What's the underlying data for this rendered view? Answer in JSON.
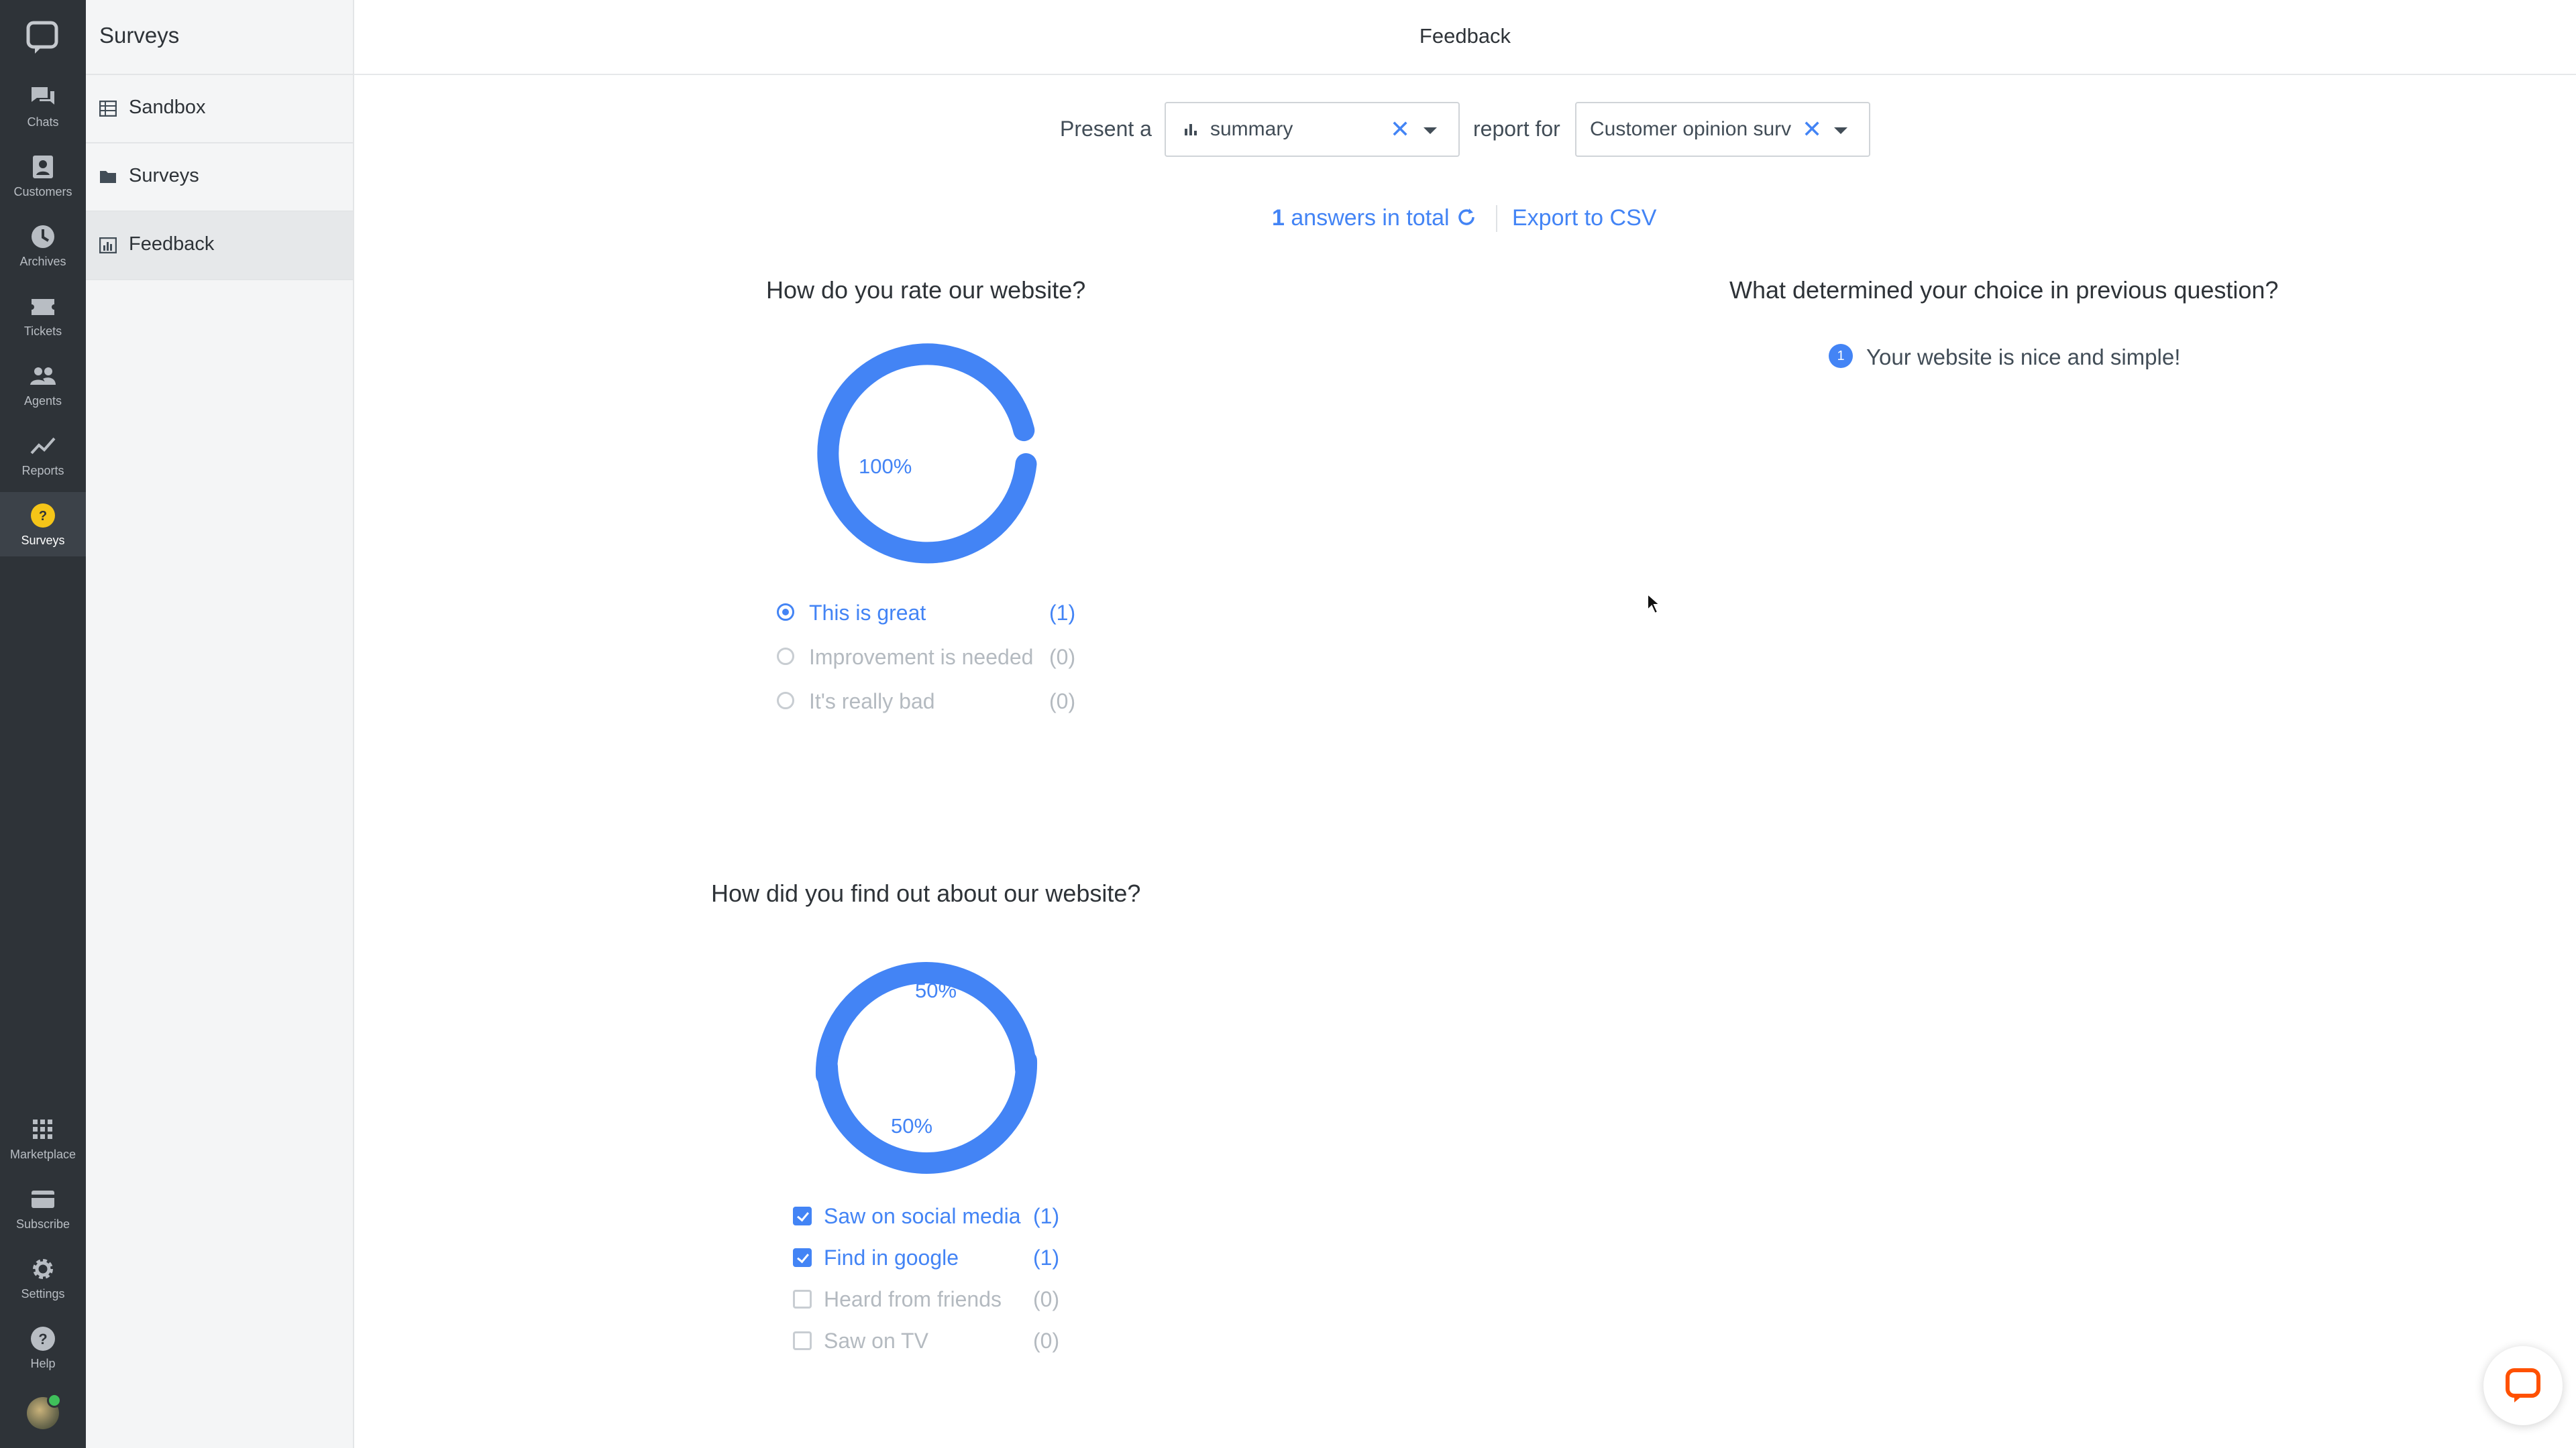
{
  "nav": {
    "items": [
      {
        "label": "Chats",
        "icon": "chats-icon"
      },
      {
        "label": "Customers",
        "icon": "customers-icon"
      },
      {
        "label": "Archives",
        "icon": "archives-icon"
      },
      {
        "label": "Tickets",
        "icon": "tickets-icon"
      },
      {
        "label": "Agents",
        "icon": "agents-icon"
      },
      {
        "label": "Reports",
        "icon": "reports-icon"
      },
      {
        "label": "Surveys",
        "icon": "surveys-icon",
        "active": true
      }
    ],
    "bottom_items": [
      {
        "label": "Marketplace",
        "icon": "marketplace-icon"
      },
      {
        "label": "Subscribe",
        "icon": "subscribe-icon"
      },
      {
        "label": "Settings",
        "icon": "gear-icon"
      },
      {
        "label": "Help",
        "icon": "help-icon"
      }
    ]
  },
  "sidebar": {
    "title": "Surveys",
    "items": [
      {
        "label": "Sandbox",
        "icon": "table-icon"
      },
      {
        "label": "Surveys",
        "icon": "folder-icon"
      },
      {
        "label": "Feedback",
        "icon": "bar-chart-icon",
        "active": true
      }
    ]
  },
  "header": {
    "title": "Feedback"
  },
  "controls": {
    "present_label": "Present a",
    "present_value": "summary",
    "report_for_label": "report for",
    "report_for_value": "Customer opinion surv"
  },
  "summary": {
    "answers_count": "1",
    "answers_label": "answers in total",
    "export_label": "Export to CSV"
  },
  "questions": [
    {
      "title": "How do you rate our website?",
      "type": "radio",
      "percentages": [
        "100%"
      ],
      "options": [
        {
          "label": "This is great",
          "count": "(1)",
          "selected": true
        },
        {
          "label": "Improvement is needed",
          "count": "(0)",
          "selected": false
        },
        {
          "label": "It's really bad",
          "count": "(0)",
          "selected": false
        }
      ]
    },
    {
      "title": "What determined your choice in previous question?",
      "type": "text",
      "answers": [
        {
          "index": "1",
          "text": "Your website is nice and simple!"
        }
      ]
    },
    {
      "title": "How did you find out about our website?",
      "type": "checkbox",
      "percentages": [
        "50%",
        "50%"
      ],
      "options": [
        {
          "label": "Saw on social media",
          "count": "(1)",
          "selected": true
        },
        {
          "label": "Find in google",
          "count": "(1)",
          "selected": true
        },
        {
          "label": "Heard from friends",
          "count": "(0)",
          "selected": false
        },
        {
          "label": "Saw on TV",
          "count": "(0)",
          "selected": false
        }
      ]
    }
  ],
  "colors": {
    "accent": "#4384f5",
    "rail": "#2e3338",
    "muted": "#b4bac0"
  }
}
